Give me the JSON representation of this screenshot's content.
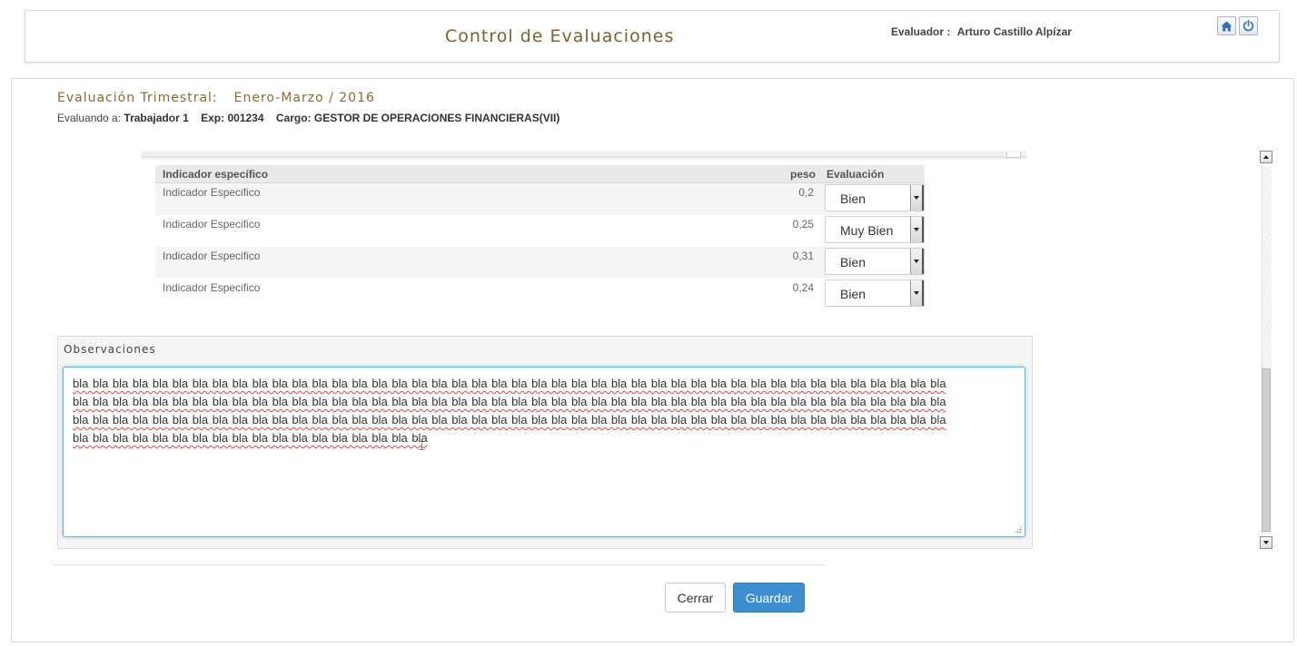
{
  "header": {
    "title": "Control de Evaluaciones",
    "evaluador_label": "Evaluador :",
    "evaluador_name": "Arturo Castillo Alpízar"
  },
  "evaluation": {
    "type_label": "Evaluación Trimestral:",
    "period": "Enero-Marzo / 2016",
    "evaluando_label": "Evaluando a:",
    "worker": "Trabajador 1",
    "exp_label": "Exp:",
    "exp_value": "001234",
    "cargo_label": "Cargo:",
    "cargo_value": "GESTOR DE OPERACIONES FINANCIERAS(VII)"
  },
  "table": {
    "headers": [
      "Indicador específico",
      "peso",
      "Evaluación"
    ],
    "rows": [
      {
        "indicator": "Indicador Especifico",
        "peso": "0,2",
        "evaluacion": "Bien"
      },
      {
        "indicator": "Indicador Especifico",
        "peso": "0,25",
        "evaluacion": "Muy Bien"
      },
      {
        "indicator": "Indicador Especifico",
        "peso": "0,31",
        "evaluacion": "Bien"
      },
      {
        "indicator": "Indicador Especifico",
        "peso": "0,24",
        "evaluacion": "Bien"
      }
    ]
  },
  "observaciones": {
    "label": "Observaciones",
    "lines": [
      "bla bla bla bla bla bla bla bla bla bla bla bla bla bla bla bla bla bla bla bla bla bla bla bla bla bla bla bla bla bla bla bla bla bla bla bla bla bla bla bla bla bla bla bla",
      "bla bla bla bla bla bla bla bla bla bla bla bla bla bla bla bla bla bla bla bla bla bla bla bla bla bla bla bla bla bla bla bla bla bla bla bla bla bla bla bla bla bla bla bla",
      "bla bla bla bla bla bla bla bla bla bla bla bla bla bla bla bla bla bla bla bla bla bla bla bla bla bla bla bla bla bla bla bla bla bla bla bla bla bla bla bla bla bla bla bla",
      "bla bla bla bla bla bla bla bla bla bla bla bla bla bla bla bla bla bla"
    ]
  },
  "buttons": {
    "cerrar": "Cerrar",
    "guardar": "Guardar"
  },
  "icons": {
    "home": "home-icon",
    "power": "power-icon"
  },
  "colors": {
    "title": "#7a6233",
    "primary_button": "#3b8fd0",
    "focus_border": "#6aaedc"
  }
}
